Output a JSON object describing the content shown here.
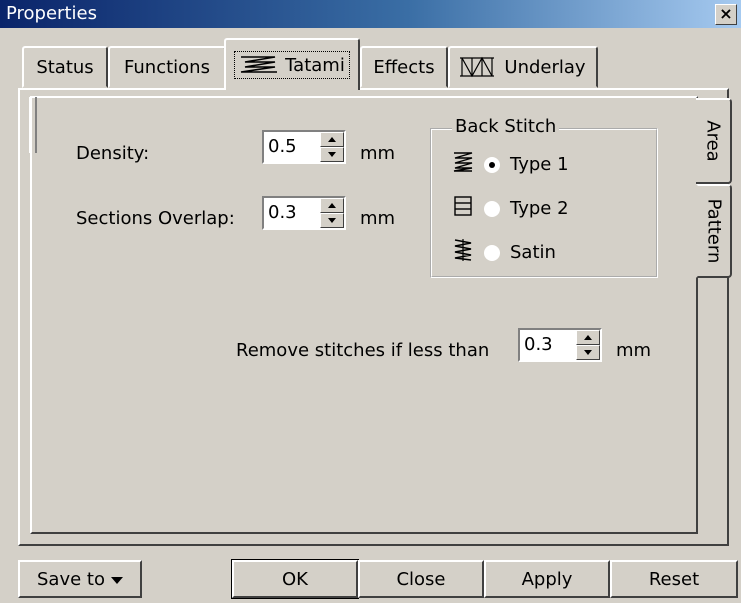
{
  "window": {
    "title": "Properties",
    "close_glyph": "×"
  },
  "tabs": [
    {
      "label": "Status",
      "icon": null,
      "active": false
    },
    {
      "label": "Functions",
      "icon": null,
      "active": false
    },
    {
      "label": "Tatami",
      "icon": "tatami-stitch-icon",
      "active": true
    },
    {
      "label": "Effects",
      "icon": null,
      "active": false
    },
    {
      "label": "Underlay",
      "icon": "underlay-stitch-icon",
      "active": false
    }
  ],
  "side_tabs": [
    {
      "label": "Area",
      "active": true
    },
    {
      "label": "Pattern",
      "active": false
    }
  ],
  "fields": {
    "density": {
      "label": "Density:",
      "value": "0.5",
      "unit": "mm"
    },
    "overlap": {
      "label": "Sections Overlap:",
      "value": "0.3",
      "unit": "mm"
    },
    "remove": {
      "label": "Remove stitches if less than",
      "value": "0.3",
      "unit": "mm"
    }
  },
  "back_stitch": {
    "title": "Back Stitch",
    "options": [
      {
        "label": "Type 1",
        "icon": "zigzag-stitch-icon",
        "checked": true
      },
      {
        "label": "Type 2",
        "icon": "parallel-stitch-icon",
        "checked": false
      },
      {
        "label": "Satin",
        "icon": "satin-stitch-icon",
        "checked": false
      }
    ]
  },
  "buttons": {
    "save_to": "Save to",
    "ok": "OK",
    "close": "Close",
    "apply": "Apply",
    "reset": "Reset"
  },
  "colors": {
    "face": "#d4d0c8",
    "title_start": "#0a246a",
    "title_end": "#a6caf0"
  }
}
